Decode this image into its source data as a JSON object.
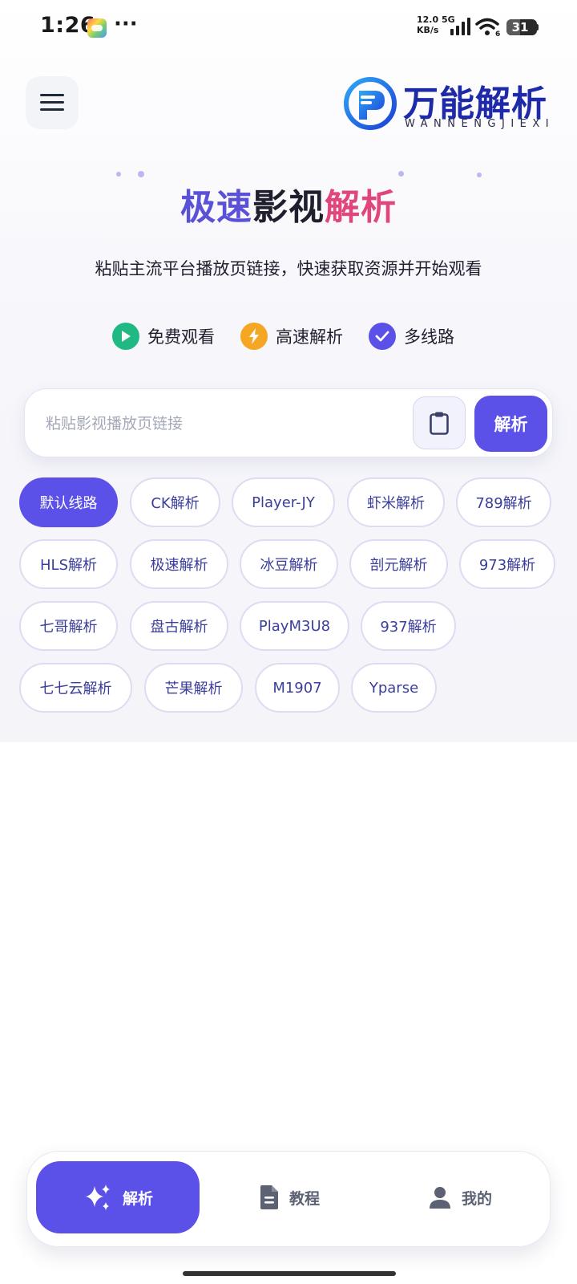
{
  "status_bar": {
    "time": "1:26",
    "more": "···",
    "net_speed_value": "12.0",
    "net_speed_unit": "KB/s",
    "network": "5G",
    "wifi_level": "6",
    "battery": "31"
  },
  "header": {
    "menu_icon": "hamburger-menu-icon",
    "brand_name": "万能解析",
    "brand_sub": "WANNENGJIEXI"
  },
  "hero": {
    "title_part1": "极速",
    "title_part2": "影视",
    "title_part3": "解析",
    "subtitle": "粘贴主流平台播放页链接，快速获取资源并开始观看",
    "colors": {
      "part1": "#5b51d8",
      "part2": "#1f1f2e",
      "part3": "#e0457b"
    }
  },
  "features": [
    {
      "label": "免费观看",
      "icon": "play-circle-icon",
      "color": "#20b883"
    },
    {
      "label": "高速解析",
      "icon": "lightning-icon",
      "color": "#f5a623"
    },
    {
      "label": "多线路",
      "icon": "check-circle-icon",
      "color": "#5b51e8"
    }
  ],
  "search": {
    "placeholder": "粘贴影视播放页链接",
    "value": "",
    "paste_icon": "clipboard-icon",
    "parse_label": "解析"
  },
  "lines": {
    "selected": "默认线路",
    "items": [
      "默认线路",
      "CK解析",
      "Player-JY",
      "虾米解析",
      "789解析",
      "HLS解析",
      "极速解析",
      "冰豆解析",
      "剖元解析",
      "973解析",
      "七哥解析",
      "盘古解析",
      "PlayM3U8",
      "937解析",
      "七七云解析",
      "芒果解析",
      "M1907",
      "Yparse"
    ]
  },
  "bottom_nav": {
    "items": [
      {
        "label": "解析",
        "icon": "sparkle-icon",
        "active": true
      },
      {
        "label": "教程",
        "icon": "document-icon",
        "active": false
      },
      {
        "label": "我的",
        "icon": "user-icon",
        "active": false
      }
    ]
  },
  "theme": {
    "accent": "#5b51e8",
    "brand_blue": "#1e2aa8"
  }
}
